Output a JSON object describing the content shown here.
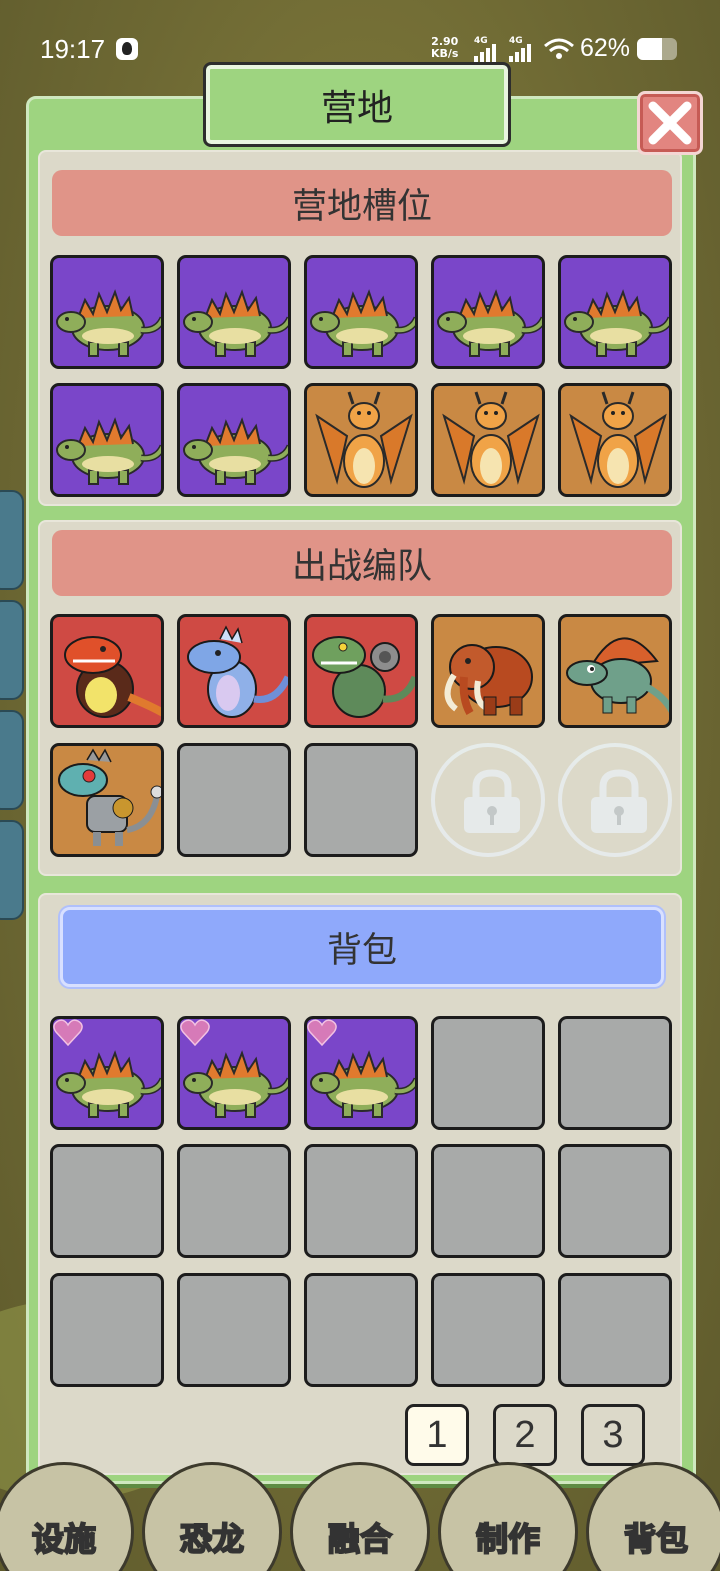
{
  "status_bar": {
    "time": "19:17",
    "net_speed_value": "2.90",
    "net_speed_unit": "KB/s",
    "signal_1_label": "4G",
    "signal_2_label": "4G",
    "battery_text": "62%",
    "battery_level": 0.62
  },
  "dialog": {
    "title": "营地",
    "close_icon": "close-x-icon"
  },
  "camp_slots": {
    "title": "营地槽位",
    "slots": [
      "stegosaurus",
      "stegosaurus",
      "stegosaurus",
      "stegosaurus",
      "stegosaurus",
      "stegosaurus",
      "stegosaurus",
      "dragon",
      "dragon",
      "dragon"
    ]
  },
  "battle_team": {
    "title": "出战编队",
    "slots": [
      "fire-dino",
      "ice-dino",
      "mech-trex",
      "mammoth",
      "spinosaurus",
      "robot-dino",
      "empty",
      "empty",
      "locked",
      "locked"
    ]
  },
  "backpack": {
    "title": "背包",
    "slots": [
      "stegosaurus",
      "stegosaurus",
      "stegosaurus",
      "empty",
      "empty",
      "empty",
      "empty",
      "empty",
      "empty",
      "empty",
      "empty",
      "empty",
      "empty",
      "empty",
      "empty"
    ],
    "pages": [
      "1",
      "2",
      "3"
    ],
    "current_page": "1"
  },
  "bottom_nav": [
    "设施",
    "恐龙",
    "融合",
    "制作",
    "背包"
  ],
  "colors": {
    "panel_green": "#9ed480",
    "header_red": "#e09488",
    "header_blue": "#8fa9fb",
    "slot_purple": "#7a46c9",
    "slot_orange": "#c98944",
    "slot_red": "#cf4a44",
    "slot_empty": "#a8aaa9"
  }
}
